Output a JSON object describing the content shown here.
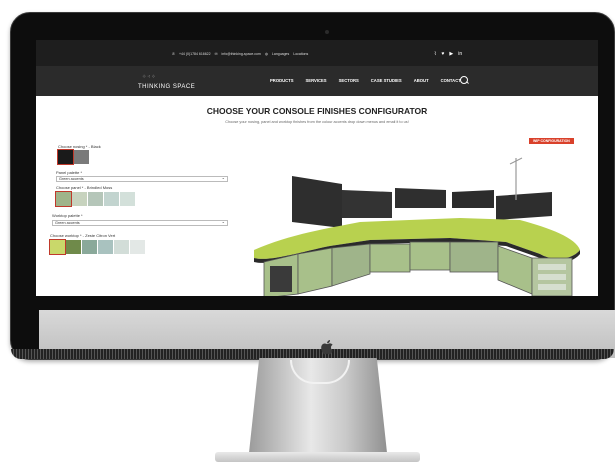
{
  "site": {
    "phone": "+44 (0)1784 616622",
    "email": "info@thinking-space.com",
    "languages": "Languages",
    "locations": "Locations",
    "socials": [
      "rss",
      "twitter",
      "youtube",
      "linkedin"
    ],
    "logo": "THINKING SPACE",
    "nav": [
      "PRODUCTS",
      "SERVICES",
      "SECTORS",
      "CASE STUDIES",
      "ABOUT",
      "CONTACT"
    ]
  },
  "page": {
    "title": "CHOOSE YOUR CONSOLE FINISHES CONFIGURATOR",
    "subtitle": "Choose your nosing, panel and worktop finishes from the colour accents drop down menus and email it to us!",
    "wip_badge": "WIP CONFIGURATION"
  },
  "form": {
    "nosing_label": "Choose nosing * - Black",
    "nosing_swatches": [
      "#1a1a1a",
      "#7a7a7a"
    ],
    "panel_palette_label": "Panel palette *",
    "panel_palette_value": "Green accents",
    "panel_label": "Choose panel * - Brindled Moss",
    "panel_swatches": [
      "#9fb48a",
      "#c7d3be",
      "#b5c6b9",
      "#c2d4cf",
      "#d3e0da"
    ],
    "worktop_palette_label": "Worktop palette *",
    "worktop_palette_value": "Green accents",
    "worktop_label": "Choose worktop * - Zeste Citron Vert",
    "worktop_swatches": [
      "#c9d86a",
      "#6f8a4a",
      "#8aa99a",
      "#a9c2bf",
      "#d2ddd8",
      "#e3e8e6"
    ]
  },
  "colors": {
    "accent": "#c0392b",
    "worktop": "#b8d14f",
    "panel": "#a8c08a",
    "frame": "#2a2a2a"
  }
}
